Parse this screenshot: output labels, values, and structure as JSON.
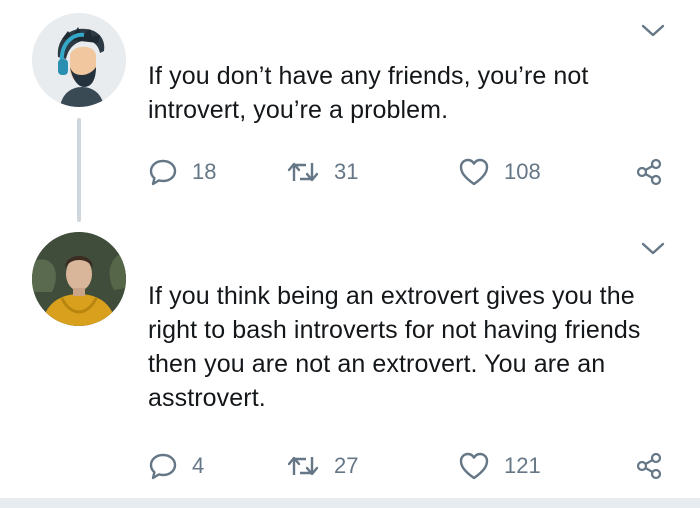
{
  "tweets": [
    {
      "avatar_icon": "illustrated-bearded-man-avatar",
      "text": "If you don’t have any friends, you’re not introvert, you’re a problem.",
      "stats": {
        "replies": "18",
        "retweets": "31",
        "likes": "108"
      }
    },
    {
      "avatar_icon": "photo-person-yellow-hoodie-avatar",
      "text": "If you think being an extrovert gives you the right to bash introverts for not having friends then you are not an extrovert. You are an asstrovert.",
      "stats": {
        "replies": "4",
        "retweets": "27",
        "likes": "121"
      }
    }
  ],
  "icons": {
    "reply": "reply-icon",
    "retweet": "retweet-icon",
    "like": "heart-icon",
    "share": "share-icon",
    "menu": "chevron-down-icon"
  },
  "colors": {
    "icon_gray": "#657786",
    "text": "#14171a",
    "thread_line": "#cfd6dc",
    "background": "#ffffff"
  }
}
